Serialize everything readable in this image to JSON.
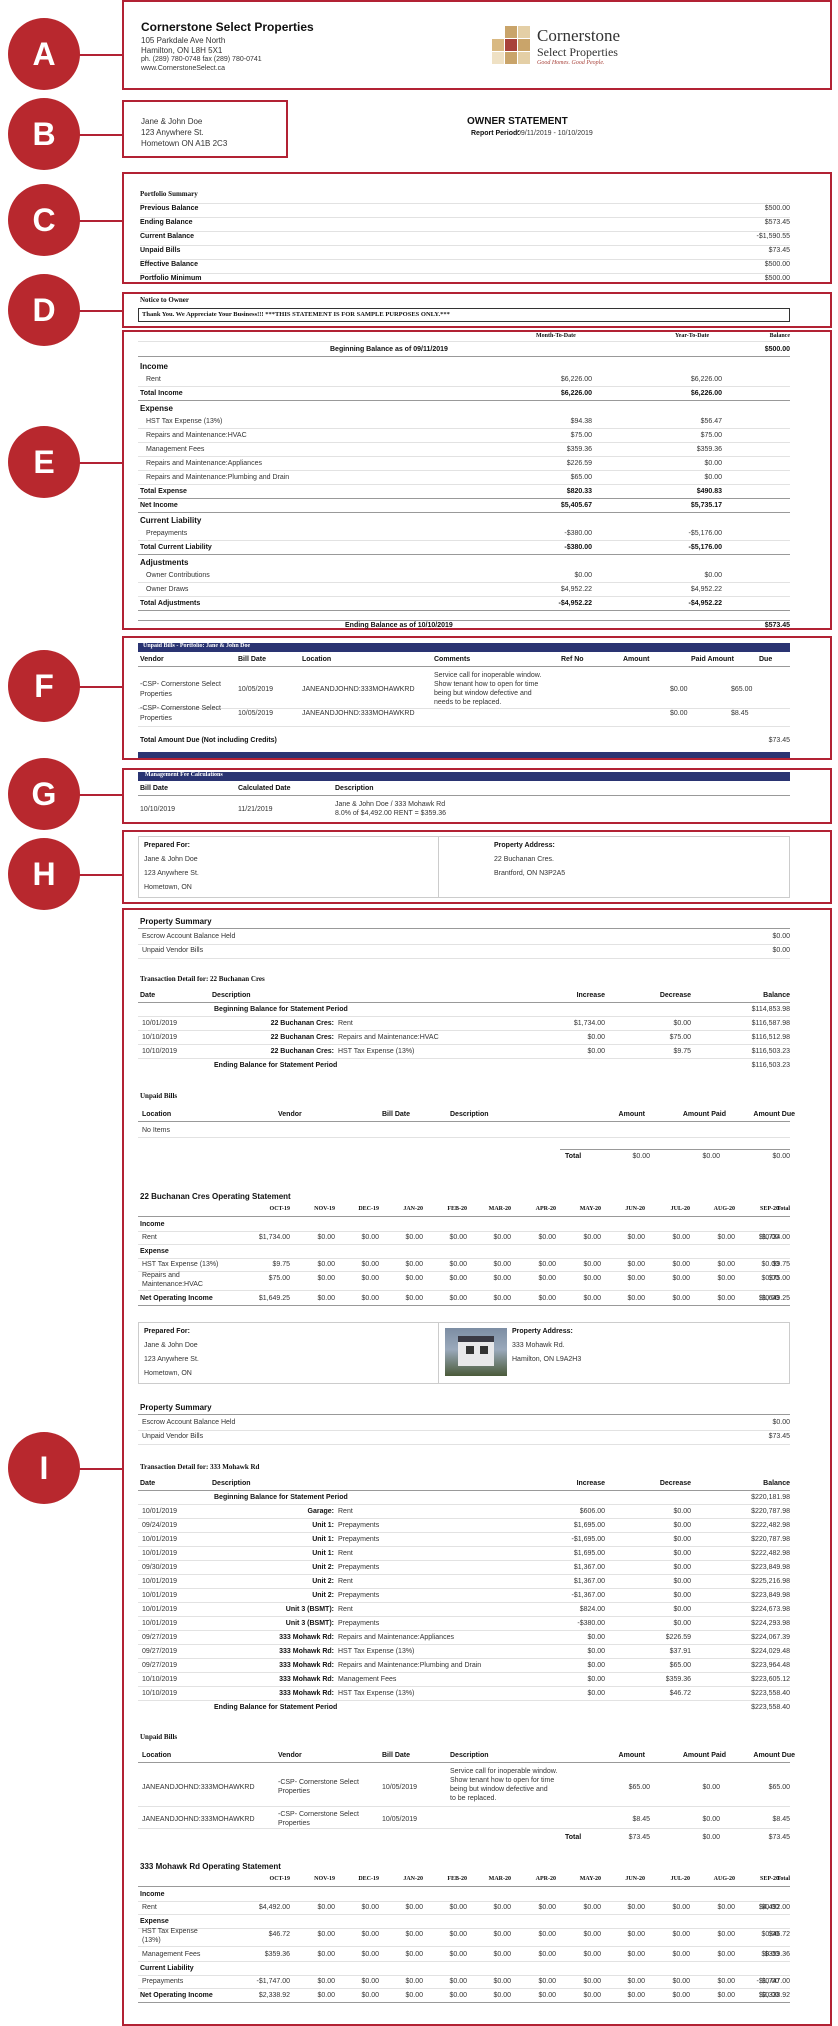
{
  "company": {
    "name": "Cornerstone Select Properties",
    "addr1": "105 Parkdale Ave North",
    "addr2": "Hamilton, ON L8H 5X1",
    "phone": "ph. (289) 780-0748 fax (289) 780-0741",
    "web": "www.CornerstoneSelect.ca",
    "logo_line1": "Cornerstone",
    "logo_line2": "Select Properties",
    "logo_tag": "Good Homes. Good People."
  },
  "badges": [
    "A",
    "B",
    "C",
    "D",
    "E",
    "F",
    "G",
    "H",
    "I"
  ],
  "owner": {
    "name": "Jane & John Doe",
    "addr1": "123 Anywhere St.",
    "addr2": "Hometown ON A1B 2C3"
  },
  "statement": {
    "title": "OWNER STATEMENT",
    "period_label": "Report Period:",
    "period": "09/11/2019 - 10/10/2019"
  },
  "portfolio": {
    "title": "Portfolio Summary",
    "rows": [
      [
        "Previous Balance",
        "$500.00"
      ],
      [
        "Ending Balance",
        "$573.45"
      ],
      [
        "Current Balance",
        "-$1,590.55"
      ],
      [
        "Unpaid Bills",
        "$73.45"
      ],
      [
        "Effective Balance",
        "$500.00"
      ],
      [
        "Portfolio Minimum",
        "$500.00"
      ]
    ]
  },
  "notice": {
    "title": "Notice to Owner",
    "text": "Thank You. We Appreciate Your Business!!! ***THIS STATEMENT IS FOR SAMPLE PURPOSES ONLY.***"
  },
  "income": {
    "col_mtd": "Month-To-Date",
    "col_ytd": "Year-To-Date",
    "col_bal": "Balance",
    "begin": "Beginning Balance as of 09/11/2019",
    "begin_val": "$500.00",
    "ending": "Ending Balance as of 10/10/2019",
    "ending_val": "$573.45",
    "rows": [
      [
        "h",
        "Income",
        "",
        ""
      ],
      [
        "i",
        "Rent",
        "$6,226.00",
        "$6,226.00"
      ],
      [
        "t",
        "Total Income",
        "$6,226.00",
        "$6,226.00"
      ],
      [
        "h",
        "Expense",
        "",
        ""
      ],
      [
        "i",
        "HST Tax Expense (13%)",
        "$94.38",
        "$56.47"
      ],
      [
        "i",
        "Repairs and Maintenance:HVAC",
        "$75.00",
        "$75.00"
      ],
      [
        "i",
        "Management Fees",
        "$359.36",
        "$359.36"
      ],
      [
        "i",
        "Repairs and Maintenance:Appliances",
        "$226.59",
        "$0.00"
      ],
      [
        "i",
        "Repairs and Maintenance:Plumbing and Drain",
        "$65.00",
        "$0.00"
      ],
      [
        "t",
        "Total Expense",
        "$820.33",
        "$490.83"
      ],
      [
        "t",
        "Net Income",
        "$5,405.67",
        "$5,735.17"
      ],
      [
        "h",
        "Current Liability",
        "",
        ""
      ],
      [
        "i",
        "Prepayments",
        "-$380.00",
        "-$5,176.00"
      ],
      [
        "t",
        "Total Current Liability",
        "-$380.00",
        "-$5,176.00"
      ],
      [
        "h",
        "Adjustments",
        "",
        ""
      ],
      [
        "i",
        "Owner Contributions",
        "$0.00",
        "$0.00"
      ],
      [
        "i",
        "Owner Draws",
        "$4,952.22",
        "$4,952.22"
      ],
      [
        "t",
        "Total Adjustments",
        "-$4,952.22",
        "-$4,952.22"
      ]
    ]
  },
  "unpaid": {
    "bar": "Unpaid Bills - Portfolio: Jane & John Doe",
    "headers": [
      "Vendor",
      "Bill Date",
      "Location",
      "Comments",
      "Ref No",
      "Amount",
      "Paid Amount",
      "Due"
    ],
    "rows": [
      {
        "vendor1": "-CSP- Cornerstone Select",
        "vendor2": "Properties",
        "date": "10/05/2019",
        "loc": "JANEANDJOHND:333MOHAWKRD",
        "c1": "Service call for inoperable window.",
        "c2": "Show tenant how to open for time",
        "c3": "being but window defective and",
        "c4": "needs to be replaced.",
        "amount": "$0.00",
        "paid": "$65.00"
      },
      {
        "vendor1": "-CSP- Cornerstone Select",
        "vendor2": "Properties",
        "date": "10/05/2019",
        "loc": "JANEANDJOHND:333MOHAWKRD",
        "c1": "",
        "c2": "",
        "c3": "",
        "c4": "",
        "amount": "$0.00",
        "paid": "$8.45"
      }
    ],
    "total_label": "Total Amount Due (Not including Credits)",
    "total": "$73.45"
  },
  "mgmt": {
    "bar": "Management Fee Calculations",
    "headers": [
      "Bill Date",
      "Calculated Date",
      "Description"
    ],
    "date": "10/10/2019",
    "calc": "11/21/2019",
    "d1": "Jane & John Doe / 333 Mohawk Rd",
    "d2": "8.0% of $4,492.00 RENT = $359.36"
  },
  "prepared": {
    "label": "Prepared For:",
    "name": "Jane & John Doe",
    "addr1": "123 Anywhere St.",
    "addr2": "Hometown, ON",
    "prop_label": "Property Address:",
    "prop1": "22 Buchanan Cres.",
    "prop2": "Brantford, ON N3P2A5"
  },
  "p1": {
    "summary_title": "Property Summary",
    "summary": [
      [
        "Escrow Account Balance Held",
        "$0.00"
      ],
      [
        "Unpaid Vendor Bills",
        "$0.00"
      ]
    ],
    "detail_title": "Transaction Detail for: 22 Buchanan Cres",
    "headers": [
      "Date",
      "Description",
      "Increase",
      "Decrease",
      "Balance"
    ],
    "begin": "Beginning Balance for Statement Period",
    "begin_val": "$114,853.98",
    "rows": [
      [
        "10/01/2019",
        "22 Buchanan Cres:",
        "Rent",
        "$1,734.00",
        "$0.00",
        "$116,587.98"
      ],
      [
        "10/10/2019",
        "22 Buchanan Cres:",
        "Repairs and Maintenance:HVAC",
        "$0.00",
        "$75.00",
        "$116,512.98"
      ],
      [
        "10/10/2019",
        "22 Buchanan Cres:",
        "HST Tax Expense (13%)",
        "$0.00",
        "$9.75",
        "$116,503.23"
      ]
    ],
    "end": "Ending Balance for Statement Period",
    "end_val": "$116,503.23",
    "unpaid_title": "Unpaid Bills",
    "unpaid_headers": [
      "Location",
      "Vendor",
      "Bill Date",
      "Description",
      "Amount",
      "Amount Paid",
      "Amount Due"
    ],
    "no_items": "No Items",
    "total_label": "Total",
    "totals": [
      "$0.00",
      "$0.00",
      "$0.00"
    ],
    "op_title": "22 Buchanan Cres Operating Statement",
    "months": [
      "OCT-19",
      "NOV-19",
      "DEC-19",
      "JAN-20",
      "FEB-20",
      "MAR-20",
      "APR-20",
      "MAY-20",
      "JUN-20",
      "JUL-20",
      "AUG-20",
      "SEP-20",
      "Total"
    ],
    "op_rows": [
      [
        "h",
        "Income"
      ],
      [
        "i",
        "Rent",
        "$1,734.00"
      ],
      [
        "h",
        "Expense"
      ],
      [
        "i",
        "HST Tax Expense (13%)",
        "$9.75"
      ],
      [
        "i2",
        "Repairs and|Maintenance:HVAC",
        "$75.00"
      ],
      [
        "t",
        "Net Operating Income",
        "$1,649.25"
      ]
    ]
  },
  "prepared2": {
    "label": "Prepared For:",
    "name": "Jane & John Doe",
    "addr1": "123 Anywhere St.",
    "addr2": "Hometown, ON",
    "prop_label": "Property Address:",
    "prop1": "333 Mohawk Rd.",
    "prop2": "Hamilton, ON L9A2H3"
  },
  "p2": {
    "summary_title": "Property Summary",
    "summary": [
      [
        "Escrow Account Balance Held",
        "$0.00"
      ],
      [
        "Unpaid Vendor Bills",
        "$73.45"
      ]
    ],
    "detail_title": "Transaction Detail for: 333 Mohawk Rd",
    "headers": [
      "Date",
      "Description",
      "Increase",
      "Decrease",
      "Balance"
    ],
    "begin": "Beginning Balance for Statement Period",
    "begin_val": "$220,181.98",
    "rows": [
      [
        "10/01/2019",
        "Garage:",
        "Rent",
        "$606.00",
        "$0.00",
        "$220,787.98"
      ],
      [
        "09/24/2019",
        "Unit 1:",
        "Prepayments",
        "$1,695.00",
        "$0.00",
        "$222,482.98"
      ],
      [
        "10/01/2019",
        "Unit 1:",
        "Prepayments",
        "-$1,695.00",
        "$0.00",
        "$220,787.98"
      ],
      [
        "10/01/2019",
        "Unit 1:",
        "Rent",
        "$1,695.00",
        "$0.00",
        "$222,482.98"
      ],
      [
        "09/30/2019",
        "Unit 2:",
        "Prepayments",
        "$1,367.00",
        "$0.00",
        "$223,849.98"
      ],
      [
        "10/01/2019",
        "Unit 2:",
        "Rent",
        "$1,367.00",
        "$0.00",
        "$225,216.98"
      ],
      [
        "10/01/2019",
        "Unit 2:",
        "Prepayments",
        "-$1,367.00",
        "$0.00",
        "$223,849.98"
      ],
      [
        "10/01/2019",
        "Unit 3 (BSMT):",
        "Rent",
        "$824.00",
        "$0.00",
        "$224,673.98"
      ],
      [
        "10/01/2019",
        "Unit 3 (BSMT):",
        "Prepayments",
        "-$380.00",
        "$0.00",
        "$224,293.98"
      ],
      [
        "09/27/2019",
        "333 Mohawk Rd:",
        "Repairs and Maintenance:Appliances",
        "$0.00",
        "$226.59",
        "$224,067.39"
      ],
      [
        "09/27/2019",
        "333 Mohawk Rd:",
        "HST Tax Expense (13%)",
        "$0.00",
        "$37.91",
        "$224,029.48"
      ],
      [
        "09/27/2019",
        "333 Mohawk Rd:",
        "Repairs and Maintenance:Plumbing and Drain",
        "$0.00",
        "$65.00",
        "$223,964.48"
      ],
      [
        "10/10/2019",
        "333 Mohawk Rd:",
        "Management Fees",
        "$0.00",
        "$359.36",
        "$223,605.12"
      ],
      [
        "10/10/2019",
        "333 Mohawk Rd:",
        "HST Tax Expense (13%)",
        "$0.00",
        "$46.72",
        "$223,558.40"
      ]
    ],
    "end": "Ending Balance for Statement Period",
    "end_val": "$223,558.40",
    "unpaid_title": "Unpaid Bills",
    "unpaid_headers": [
      "Location",
      "Vendor",
      "Bill Date",
      "Description",
      "Amount",
      "Amount Paid",
      "Amount Due"
    ],
    "unpaid_rows": [
      {
        "loc": "JANEANDJOHND:333MOHAWKRD",
        "v1": "-CSP- Cornerstone Select",
        "v2": "Properties",
        "date": "10/05/2019",
        "d1": "Service call for inoperable window.",
        "d2": "Show tenant how to open for time",
        "d3": "being but window defective and",
        "d4": "to be replaced.",
        "amt": "$65.00",
        "paid": "$0.00",
        "due": "$65.00"
      },
      {
        "loc": "JANEANDJOHND:333MOHAWKRD",
        "v1": "-CSP- Cornerstone Select",
        "v2": "Properties",
        "date": "10/05/2019",
        "d1": "",
        "d2": "",
        "d3": "",
        "d4": "",
        "amt": "$8.45",
        "paid": "$0.00",
        "due": "$8.45"
      }
    ],
    "total_label": "Total",
    "totals": [
      "$73.45",
      "$0.00",
      "$73.45"
    ],
    "op_title": "333 Mohawk Rd Operating Statement",
    "op_rows": [
      [
        "h",
        "Income"
      ],
      [
        "i",
        "Rent",
        "$4,492.00"
      ],
      [
        "h",
        "Expense"
      ],
      [
        "i2",
        "HST Tax Expense|(13%)",
        "$46.72"
      ],
      [
        "i",
        "Management Fees",
        "$359.36"
      ],
      [
        "h",
        "Current Liability"
      ],
      [
        "i",
        "Prepayments",
        "-$1,747.00"
      ],
      [
        "t",
        "Net Operating Income",
        "$2,338.92"
      ]
    ]
  },
  "zero": "$0.00"
}
